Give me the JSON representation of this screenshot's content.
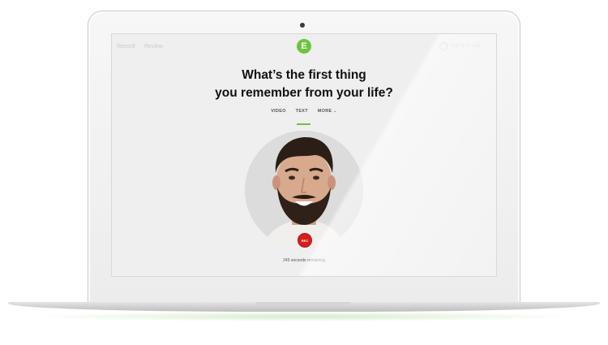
{
  "nav": {
    "record_label": "Record",
    "review_label": "Review",
    "account_label": "Sign in to edit"
  },
  "logo": {
    "glyph": "E"
  },
  "question": {
    "line1": "What’s the first thing",
    "line2": "you remember from your life?"
  },
  "tabs": [
    {
      "label": "VIDEO",
      "active": true
    },
    {
      "label": "TEXT",
      "active": false
    },
    {
      "label": "MORE",
      "active": false
    }
  ],
  "more_chevron": "⌄",
  "record_button": {
    "label": "REC"
  },
  "timer": {
    "text": "245 seconds remaining"
  },
  "colors": {
    "accent": "#6cc63b",
    "record": "#d81e1e"
  },
  "icons": [
    "user-icon",
    "chevron-down-icon"
  ]
}
